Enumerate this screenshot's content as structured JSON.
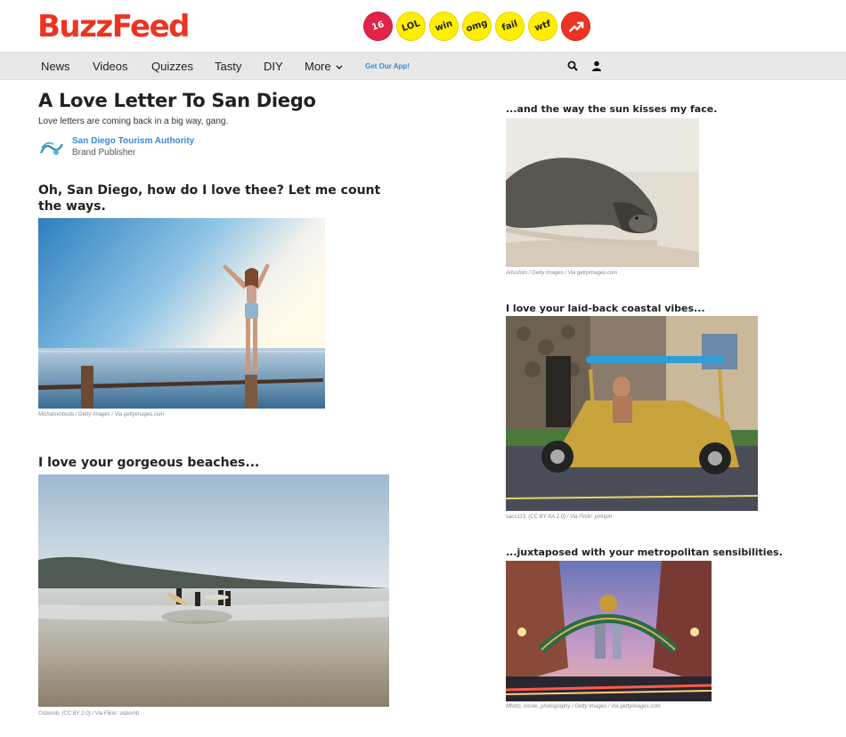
{
  "header": {
    "logo": "BuzzFeed",
    "badges": [
      {
        "label": "16",
        "style": "red"
      },
      {
        "label": "LOL",
        "style": "yellow"
      },
      {
        "label": "win",
        "style": "yellow"
      },
      {
        "label": "omg",
        "style": "yellow"
      },
      {
        "label": "fail",
        "style": "yellow"
      },
      {
        "label": "wtf",
        "style": "yellow"
      },
      {
        "label": "",
        "style": "orange",
        "icon": "trending-arrow-icon"
      }
    ]
  },
  "nav": {
    "items": [
      "News",
      "Videos",
      "Quizzes",
      "Tasty",
      "DIY",
      "More"
    ],
    "app_link": "Get Our App!",
    "icons": [
      "search-icon",
      "user-icon"
    ]
  },
  "article": {
    "title": "A Love Letter To San Diego",
    "subtitle": "Love letters are coming back in a big way, gang.",
    "publisher": "San Diego Tourism Authority",
    "publisher_role": "Brand Publisher",
    "sections": [
      {
        "heading": "Oh, San Diego, how do I love thee? Let me count the ways.",
        "credit": "Michalsvoboda / Getty Images / Via gettyimages.com"
      },
      {
        "heading": "I love your gorgeous beaches...",
        "credit": "Osbornb, (CC BY 2.0) / Via Flickr: osbornb"
      },
      {
        "heading": "...and the way the sun kisses my face.",
        "credit": "Artusfoto / Getty Images / Via gettyimages.com"
      },
      {
        "heading": "I love your laid-back coastal vibes...",
        "credit": "sacs113, (CC BY-SA 2.0) / Via Flickr: johnpin"
      },
      {
        "heading": "...juxtaposed with your metropolitan sensibilities.",
        "credit": "Mfotto_nicole_photography / Getty Images / Via gettyimages.com"
      }
    ]
  }
}
